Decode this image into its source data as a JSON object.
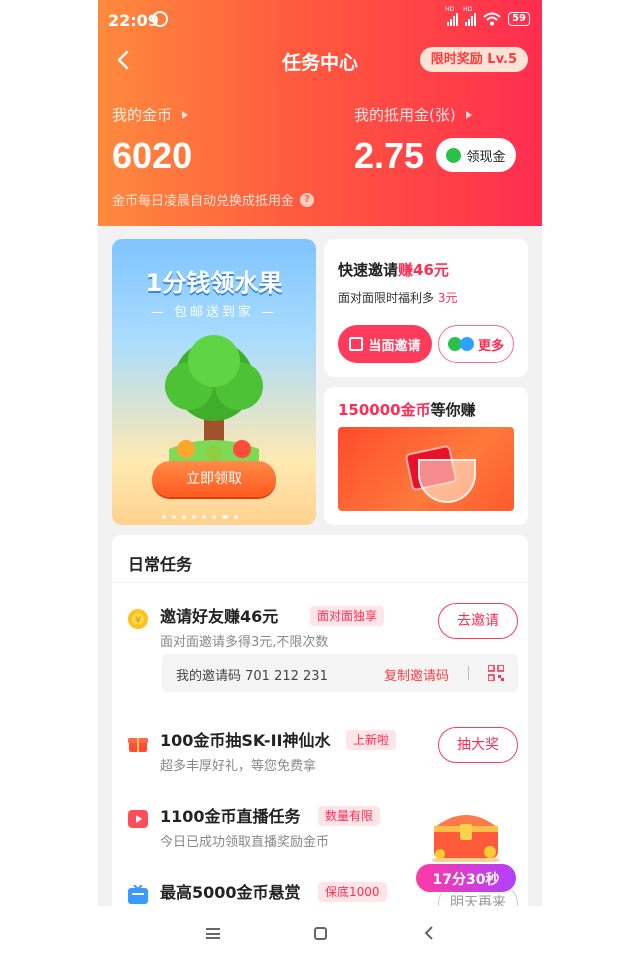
{
  "status": {
    "time": "22:09",
    "battery": "59"
  },
  "nav": {
    "title": "任务中心",
    "promo": "限时奖励  Lv.5"
  },
  "wallet": {
    "coins_label": "我的金币",
    "coins_value": "6020",
    "voucher_label": "我的抵用金(张)",
    "voucher_value": "2.75",
    "cash_button": "领现金",
    "note": "金币每日凌晨自动兑换成抵用金"
  },
  "banner": {
    "title": "1分钱领水果",
    "subtitle": "— 包邮送到家 —",
    "button": "立即领取",
    "dots": 8,
    "active_dot": 6
  },
  "invite_card": {
    "title_main": "快速邀请",
    "title_highlight": "赚46元",
    "sub_prefix": "面对面限时福利多 ",
    "sub_highlight": "3元",
    "ff_button": "当面邀请",
    "more_button": "更多"
  },
  "coin_card": {
    "title_highlight": "150000金币",
    "title_rest": "等你赚"
  },
  "tasks": {
    "heading": "日常任务",
    "items": [
      {
        "title": "邀请好友赚46元",
        "badge": "面对面独享",
        "desc": "面对面邀请多得3元,不限次数",
        "button": "去邀请",
        "icon": "coin-icon"
      },
      {
        "title": "100金币抽SK-II神仙水",
        "badge": "上新啦",
        "desc": "超多丰厚好礼，等您免费拿",
        "button": "抽大奖",
        "icon": "gift-icon"
      },
      {
        "title": "1100金币直播任务",
        "badge": "数量有限",
        "desc": "今日已成功领取直播奖励金币",
        "button": "",
        "icon": "live-icon"
      },
      {
        "title": "最高5000金币悬赏",
        "badge": "保底1000",
        "desc": "",
        "button": "明天再来",
        "icon": "tv-icon"
      }
    ],
    "invite_code_label": "我的邀请码 701 212 231",
    "copy_code": "复制邀请码"
  },
  "float_widget": {
    "timer": "17分30秒"
  },
  "colors": {
    "accent": "#ff2d55",
    "hero_start": "#ff8a3d",
    "hero_end": "#ff2d4f",
    "timer": "#b140ff"
  }
}
